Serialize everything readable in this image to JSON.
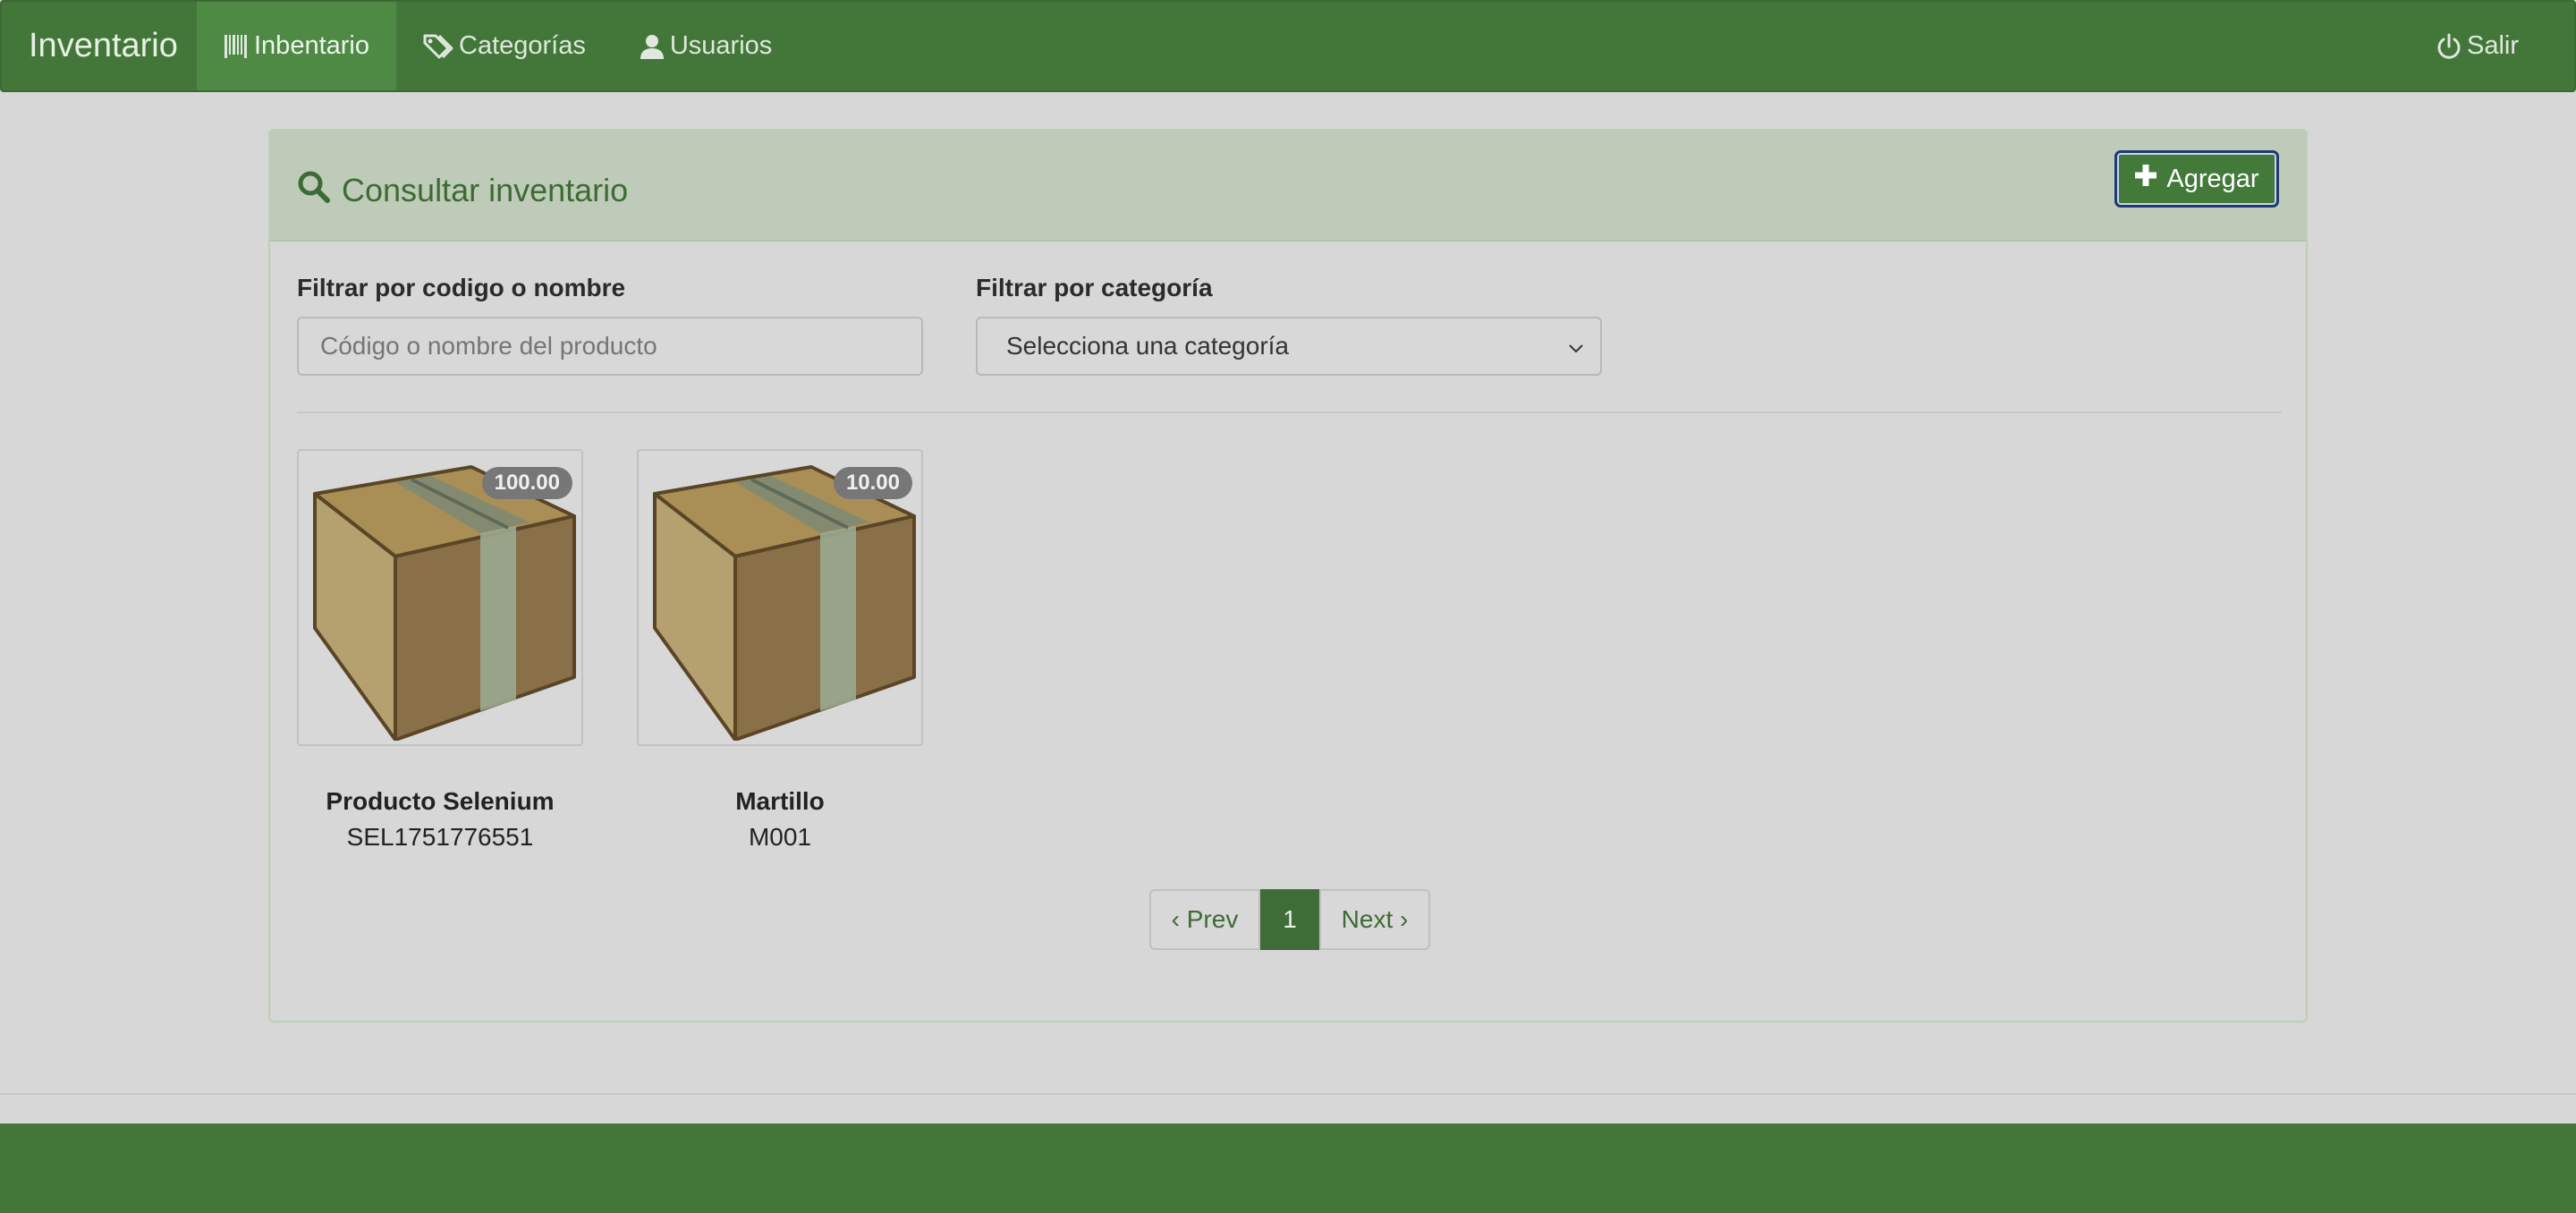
{
  "navbar": {
    "brand": "Inventario",
    "items": [
      {
        "label": "Inbentario",
        "icon": "barcode-icon",
        "active": true
      },
      {
        "label": "Categorías",
        "icon": "tags-icon",
        "active": false
      },
      {
        "label": "Usuarios",
        "icon": "user-icon",
        "active": false
      }
    ],
    "exit_label": "Salir",
    "exit_icon": "power-icon"
  },
  "panel": {
    "title": "Consultar inventario",
    "title_icon": "search-icon",
    "add_label": "Agregar",
    "add_icon": "plus-icon"
  },
  "filters": {
    "name_label": "Filtrar por codigo o nombre",
    "name_placeholder": "Código o nombre del producto",
    "category_label": "Filtrar por categoría",
    "category_selected": "Selecciona una categoría"
  },
  "products": [
    {
      "name": "Producto Selenium",
      "code": "SEL1751776551",
      "quantity": "100.00",
      "image": "box-icon"
    },
    {
      "name": "Martillo",
      "code": "M001",
      "quantity": "10.00",
      "image": "box-icon"
    }
  ],
  "pagination": {
    "prev": "‹ Prev",
    "current": "1",
    "next": "Next ›"
  },
  "colors": {
    "primary": "#43773a",
    "panel_heading": "#bfcbb9",
    "background": "#d7d7d7"
  }
}
